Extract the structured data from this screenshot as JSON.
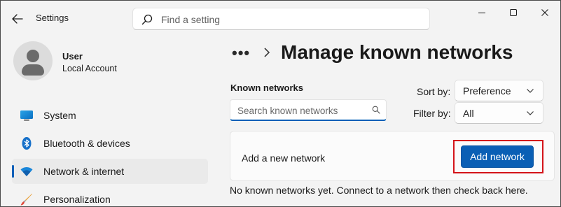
{
  "window": {
    "title": "Settings",
    "controls": [
      "minimize-icon",
      "maximize-icon",
      "close-icon"
    ]
  },
  "search": {
    "placeholder": "Find a setting",
    "value": ""
  },
  "user": {
    "name": "User",
    "account_type": "Local Account"
  },
  "sidebar": {
    "items": [
      {
        "label": "System",
        "icon": "system-icon",
        "selected": false
      },
      {
        "label": "Bluetooth & devices",
        "icon": "bluetooth-icon",
        "selected": false
      },
      {
        "label": "Network & internet",
        "icon": "wifi-icon",
        "selected": true
      },
      {
        "label": "Personalization",
        "icon": "brush-icon",
        "selected": false
      }
    ]
  },
  "breadcrumb": {
    "overflow": "•••",
    "page_title": "Manage known networks"
  },
  "known_networks": {
    "heading": "Known networks",
    "search_placeholder": "Search known networks",
    "search_value": "",
    "sort_label": "Sort by:",
    "sort_value": "Preference",
    "filter_label": "Filter by:",
    "filter_value": "All",
    "add_card_label": "Add a new network",
    "add_button_label": "Add network",
    "empty_message": "No known networks yet. Connect to a network then check back here."
  },
  "colors": {
    "accent": "#005fb8",
    "button_bg": "#0a5fb5",
    "highlight_box": "#d4141a",
    "background": "#f3f3f3"
  }
}
